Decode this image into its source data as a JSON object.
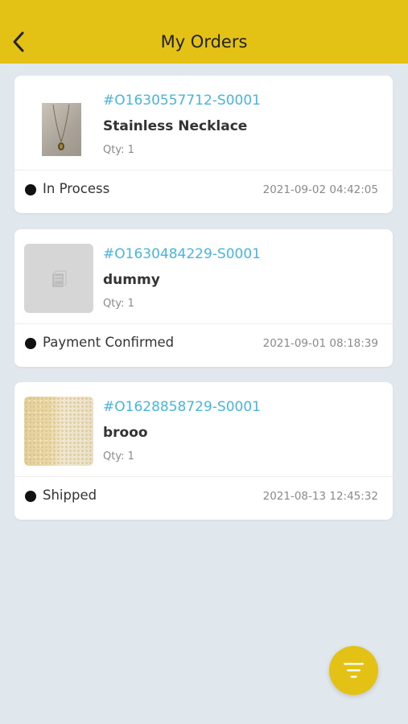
{
  "header": {
    "title": "My Orders",
    "back_icon": "chevron-left-icon"
  },
  "orders": [
    {
      "id": "#O1630557712-S0001",
      "product": "Stainless Necklace",
      "qty": "Qty: 1",
      "status": "In Process",
      "date": "2021-09-02 04:42:05",
      "thumbnail": "necklace-photo"
    },
    {
      "id": "#O1630484229-S0001",
      "product": "dummy",
      "qty": "Qty: 1",
      "status": "Payment Confirmed",
      "date": "2021-09-01 08:18:39",
      "thumbnail": "image-placeholder-icon"
    },
    {
      "id": "#O1628858729-S0001",
      "product": "brooo",
      "qty": "Qty: 1",
      "status": "Shipped",
      "date": "2021-08-13 12:45:32",
      "thumbnail": "grain-photo"
    }
  ],
  "fab": {
    "icon": "filter-icon"
  },
  "colors": {
    "accent": "#e3c115",
    "link": "#47b6dd",
    "background": "#e0e7ed"
  }
}
